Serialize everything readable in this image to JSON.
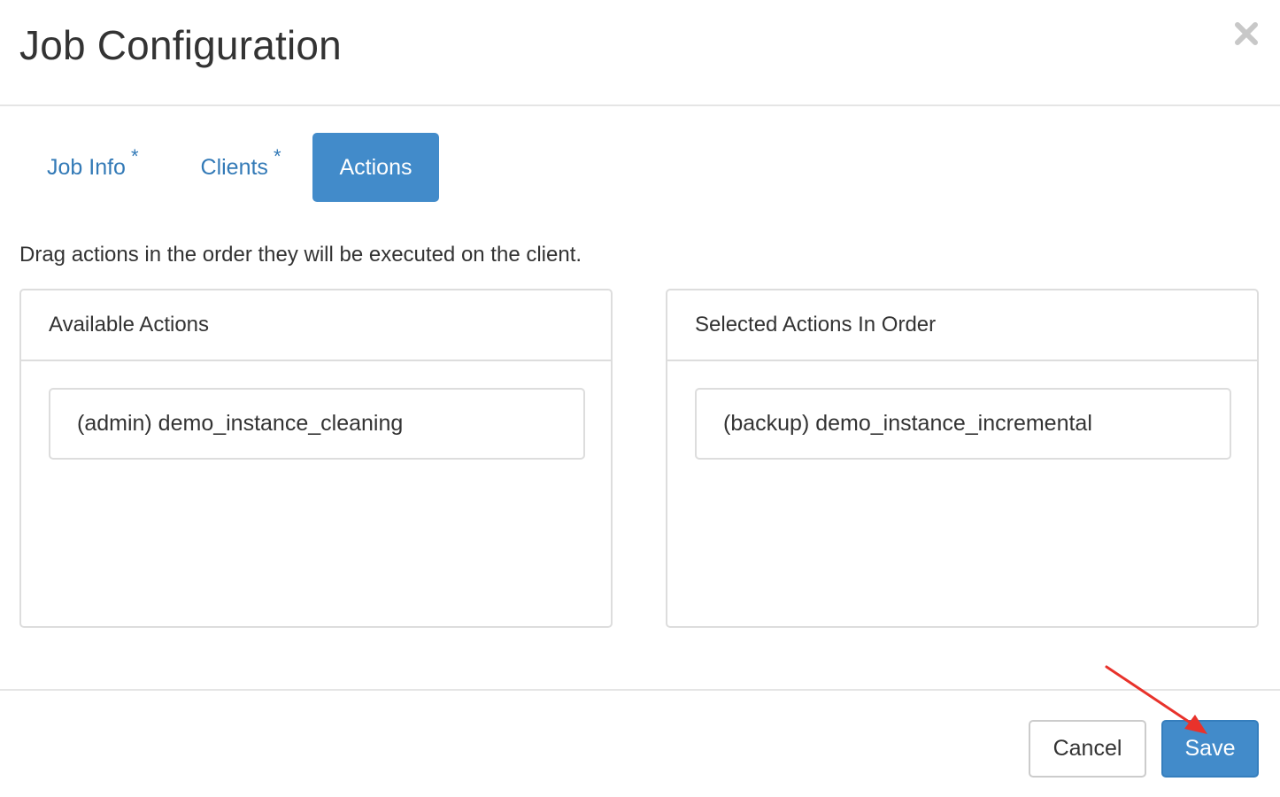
{
  "modal": {
    "title": "Job Configuration",
    "close_icon": "close-icon"
  },
  "tabs": [
    {
      "label": "Job Info",
      "required_marker": "*",
      "active": false
    },
    {
      "label": "Clients",
      "required_marker": "*",
      "active": false
    },
    {
      "label": "Actions",
      "active": true
    }
  ],
  "instructions": "Drag actions in the order they will be executed on the client.",
  "available_actions": {
    "heading": "Available Actions",
    "items": [
      "(admin) demo_instance_cleaning"
    ]
  },
  "selected_actions": {
    "heading": "Selected Actions In Order",
    "items": [
      "(backup) demo_instance_incremental"
    ]
  },
  "footer": {
    "cancel_label": "Cancel",
    "save_label": "Save"
  },
  "colors": {
    "primary": "#428bca",
    "link": "#337ab7",
    "annotation_arrow": "#e8322b"
  }
}
